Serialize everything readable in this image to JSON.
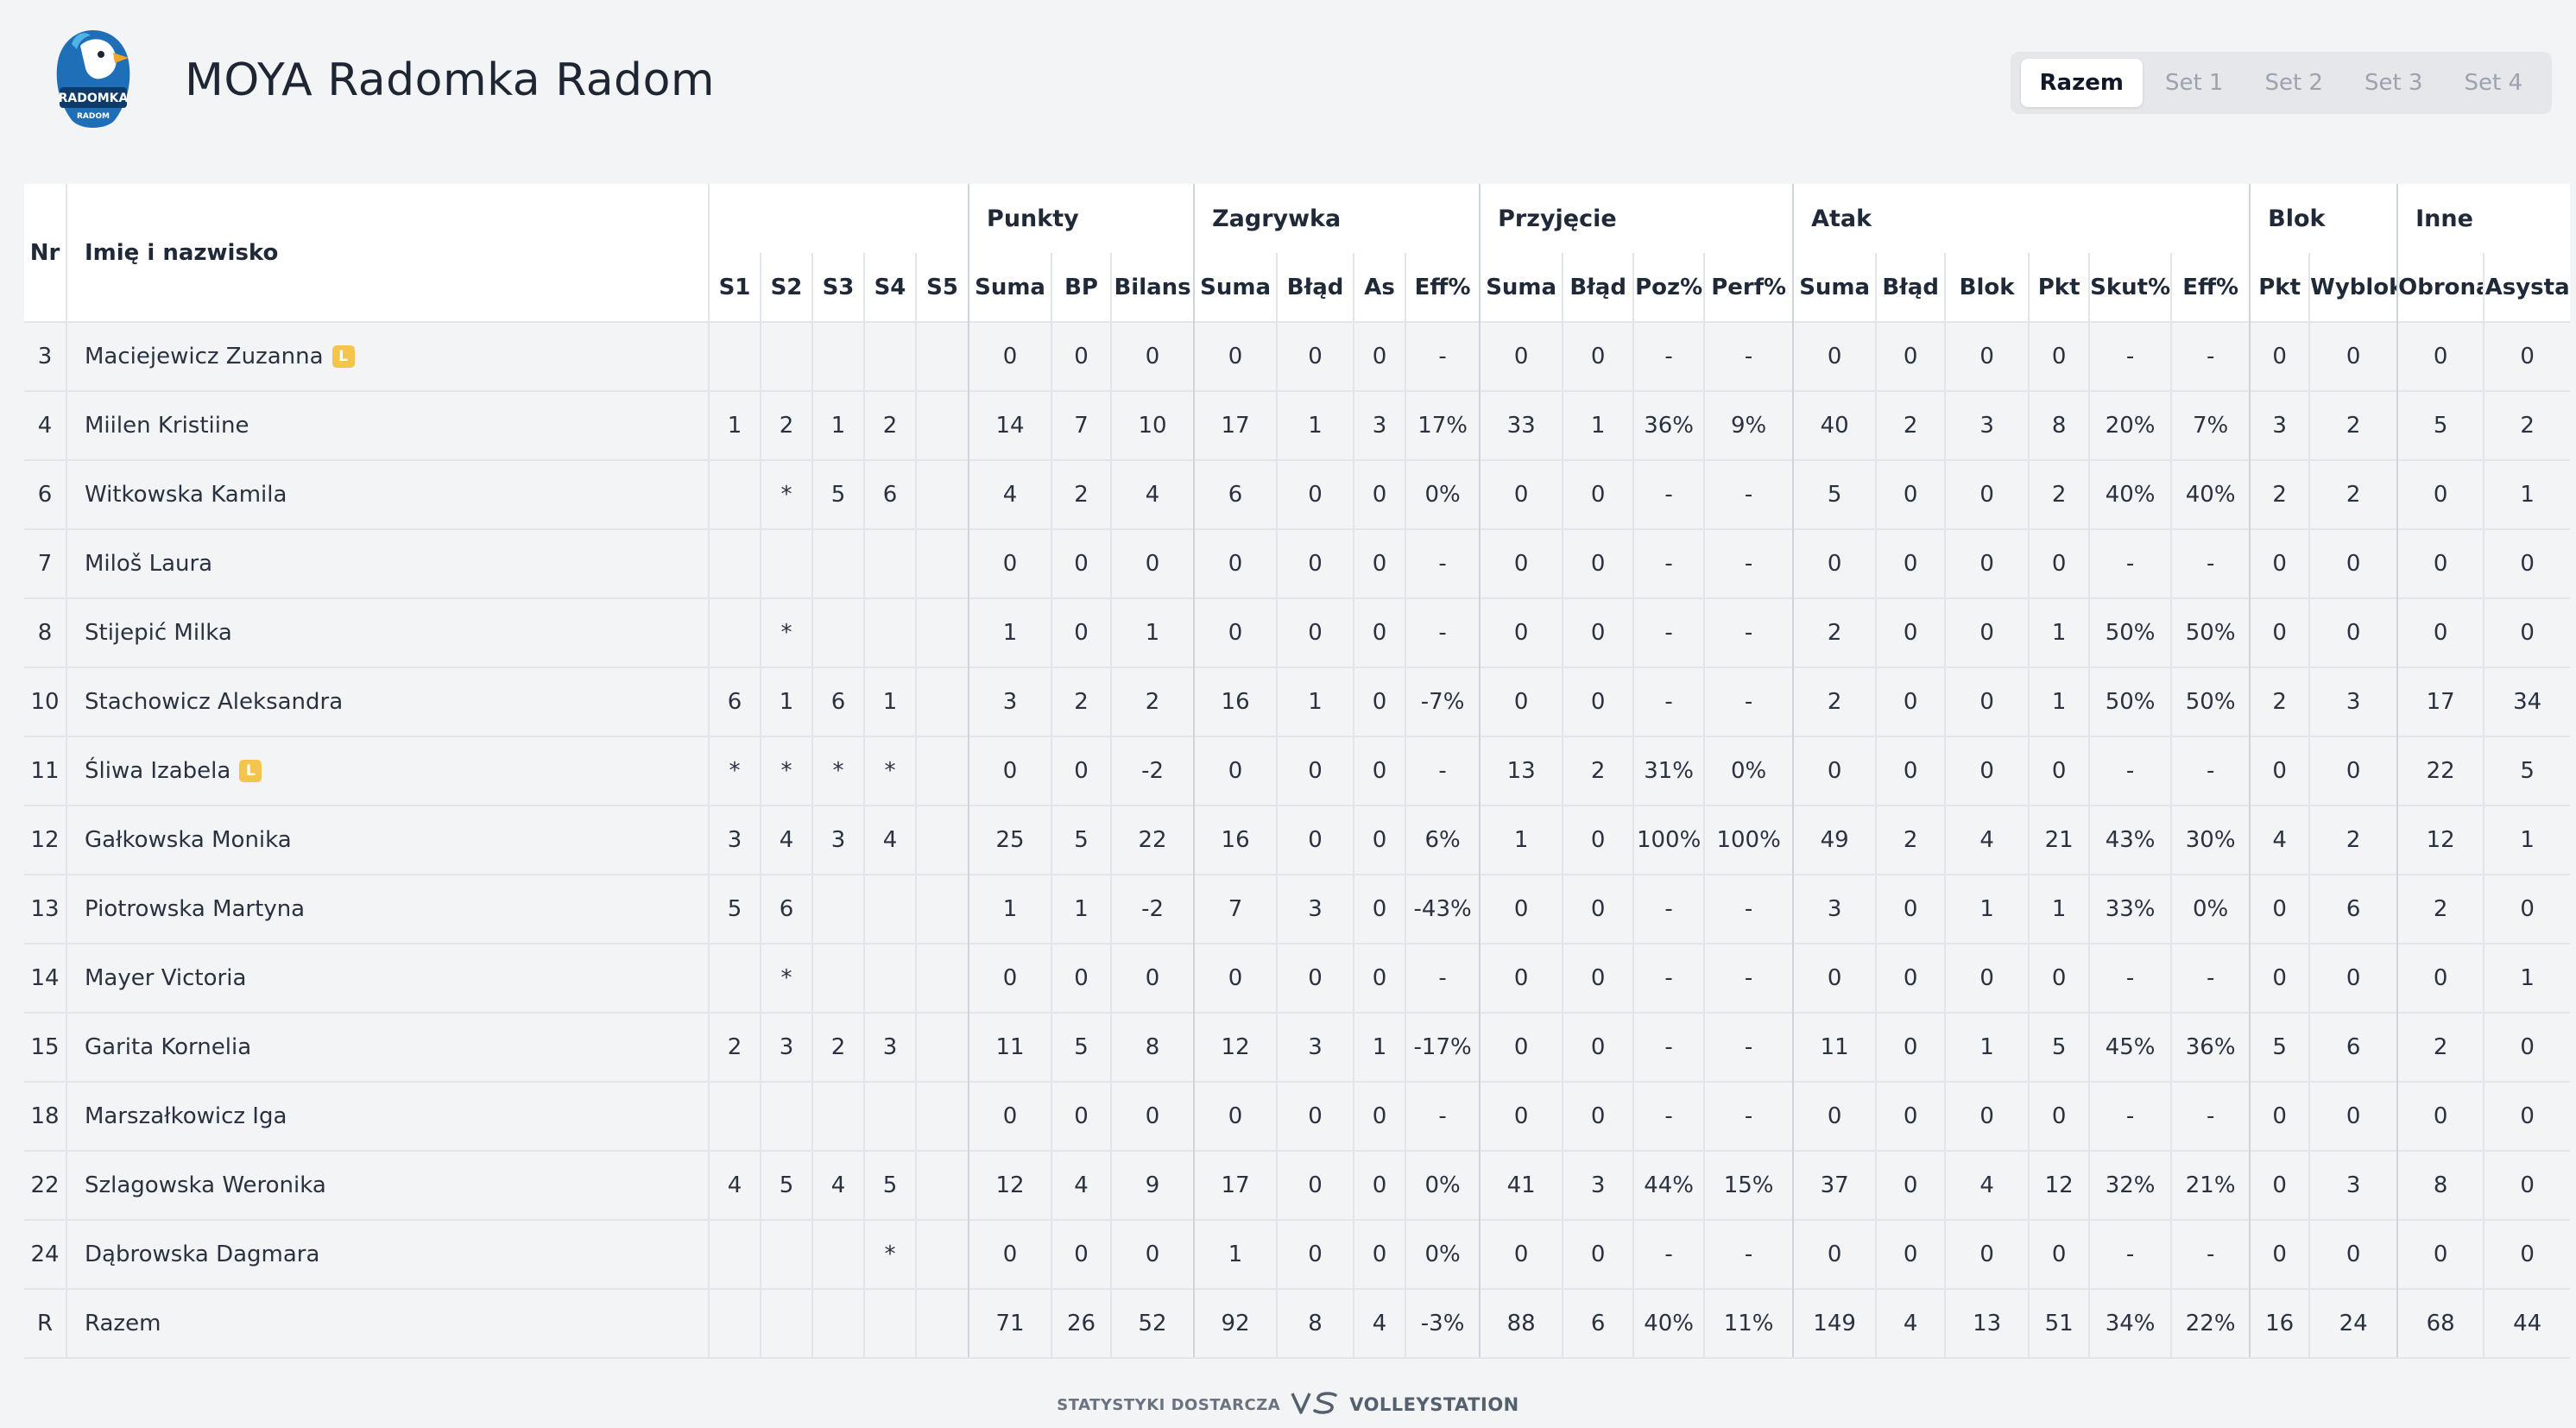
{
  "header": {
    "team_name": "MOYA Radomka Radom",
    "logo_text": "RADOMKA",
    "logo_subtext": "RADOM",
    "set_tabs": [
      "Razem",
      "Set 1",
      "Set 2",
      "Set 3",
      "Set 4"
    ],
    "active_tab": "Razem"
  },
  "table": {
    "col_nr": "Nr",
    "col_name": "Imię i nazwisko",
    "groups": [
      "Punkty",
      "Zagrywka",
      "Przyjęcie",
      "Atak",
      "Blok",
      "Inne"
    ],
    "subheaders": [
      "S1",
      "S2",
      "S3",
      "S4",
      "S5",
      "Suma",
      "BP",
      "Bilans",
      "Suma",
      "Błąd",
      "As",
      "Eff%",
      "Suma",
      "Błąd",
      "Poz%",
      "Perf%",
      "Suma",
      "Błąd",
      "Blok",
      "Pkt",
      "Skut%",
      "Eff%",
      "Pkt",
      "Wyblok",
      "Obrona",
      "Asysta"
    ],
    "rows": [
      {
        "nr": "3",
        "name": "Maciejewicz Zuzanna",
        "libero": "L",
        "cells": [
          "",
          "",
          "",
          "",
          "",
          "0",
          "0",
          "0",
          "0",
          "0",
          "0",
          "-",
          "0",
          "0",
          "-",
          "-",
          "0",
          "0",
          "0",
          "0",
          "-",
          "-",
          "0",
          "0",
          "0",
          "0"
        ]
      },
      {
        "nr": "4",
        "name": "Miilen Kristiine",
        "libero": "",
        "cells": [
          "1",
          "2",
          "1",
          "2",
          "",
          "14",
          "7",
          "10",
          "17",
          "1",
          "3",
          "17%",
          "33",
          "1",
          "36%",
          "9%",
          "40",
          "2",
          "3",
          "8",
          "20%",
          "7%",
          "3",
          "2",
          "5",
          "2"
        ]
      },
      {
        "nr": "6",
        "name": "Witkowska Kamila",
        "libero": "",
        "cells": [
          "",
          "*",
          "5",
          "6",
          "",
          "4",
          "2",
          "4",
          "6",
          "0",
          "0",
          "0%",
          "0",
          "0",
          "-",
          "-",
          "5",
          "0",
          "0",
          "2",
          "40%",
          "40%",
          "2",
          "2",
          "0",
          "1"
        ]
      },
      {
        "nr": "7",
        "name": "Miloš Laura",
        "libero": "",
        "cells": [
          "",
          "",
          "",
          "",
          "",
          "0",
          "0",
          "0",
          "0",
          "0",
          "0",
          "-",
          "0",
          "0",
          "-",
          "-",
          "0",
          "0",
          "0",
          "0",
          "-",
          "-",
          "0",
          "0",
          "0",
          "0"
        ]
      },
      {
        "nr": "8",
        "name": "Stijepić Milka",
        "libero": "",
        "cells": [
          "",
          "*",
          "",
          "",
          "",
          "1",
          "0",
          "1",
          "0",
          "0",
          "0",
          "-",
          "0",
          "0",
          "-",
          "-",
          "2",
          "0",
          "0",
          "1",
          "50%",
          "50%",
          "0",
          "0",
          "0",
          "0"
        ]
      },
      {
        "nr": "10",
        "name": "Stachowicz Aleksandra",
        "libero": "",
        "cells": [
          "6",
          "1",
          "6",
          "1",
          "",
          "3",
          "2",
          "2",
          "16",
          "1",
          "0",
          "-7%",
          "0",
          "0",
          "-",
          "-",
          "2",
          "0",
          "0",
          "1",
          "50%",
          "50%",
          "2",
          "3",
          "17",
          "34"
        ]
      },
      {
        "nr": "11",
        "name": "Śliwa Izabela",
        "libero": "L",
        "cells": [
          "*",
          "*",
          "*",
          "*",
          "",
          "0",
          "0",
          "-2",
          "0",
          "0",
          "0",
          "-",
          "13",
          "2",
          "31%",
          "0%",
          "0",
          "0",
          "0",
          "0",
          "-",
          "-",
          "0",
          "0",
          "22",
          "5"
        ]
      },
      {
        "nr": "12",
        "name": "Gałkowska Monika",
        "libero": "",
        "cells": [
          "3",
          "4",
          "3",
          "4",
          "",
          "25",
          "5",
          "22",
          "16",
          "0",
          "0",
          "6%",
          "1",
          "0",
          "100%",
          "100%",
          "49",
          "2",
          "4",
          "21",
          "43%",
          "30%",
          "4",
          "2",
          "12",
          "1"
        ]
      },
      {
        "nr": "13",
        "name": "Piotrowska Martyna",
        "libero": "",
        "cells": [
          "5",
          "6",
          "",
          "",
          "",
          "1",
          "1",
          "-2",
          "7",
          "3",
          "0",
          "-43%",
          "0",
          "0",
          "-",
          "-",
          "3",
          "0",
          "1",
          "1",
          "33%",
          "0%",
          "0",
          "6",
          "2",
          "0"
        ]
      },
      {
        "nr": "14",
        "name": "Mayer Victoria",
        "libero": "",
        "cells": [
          "",
          "*",
          "",
          "",
          "",
          "0",
          "0",
          "0",
          "0",
          "0",
          "0",
          "-",
          "0",
          "0",
          "-",
          "-",
          "0",
          "0",
          "0",
          "0",
          "-",
          "-",
          "0",
          "0",
          "0",
          "1"
        ]
      },
      {
        "nr": "15",
        "name": "Garita Kornelia",
        "libero": "",
        "cells": [
          "2",
          "3",
          "2",
          "3",
          "",
          "11",
          "5",
          "8",
          "12",
          "3",
          "1",
          "-17%",
          "0",
          "0",
          "-",
          "-",
          "11",
          "0",
          "1",
          "5",
          "45%",
          "36%",
          "5",
          "6",
          "2",
          "0"
        ]
      },
      {
        "nr": "18",
        "name": "Marszałkowicz Iga",
        "libero": "",
        "cells": [
          "",
          "",
          "",
          "",
          "",
          "0",
          "0",
          "0",
          "0",
          "0",
          "0",
          "-",
          "0",
          "0",
          "-",
          "-",
          "0",
          "0",
          "0",
          "0",
          "-",
          "-",
          "0",
          "0",
          "0",
          "0"
        ]
      },
      {
        "nr": "22",
        "name": "Szlagowska Weronika",
        "libero": "",
        "cells": [
          "4",
          "5",
          "4",
          "5",
          "",
          "12",
          "4",
          "9",
          "17",
          "0",
          "0",
          "0%",
          "41",
          "3",
          "44%",
          "15%",
          "37",
          "0",
          "4",
          "12",
          "32%",
          "21%",
          "0",
          "3",
          "8",
          "0"
        ]
      },
      {
        "nr": "24",
        "name": "Dąbrowska Dagmara",
        "libero": "",
        "cells": [
          "",
          "",
          "",
          "*",
          "",
          "0",
          "0",
          "0",
          "1",
          "0",
          "0",
          "0%",
          "0",
          "0",
          "-",
          "-",
          "0",
          "0",
          "0",
          "0",
          "-",
          "-",
          "0",
          "0",
          "0",
          "0"
        ]
      },
      {
        "nr": "R",
        "name": "Razem",
        "libero": "",
        "cells": [
          "",
          "",
          "",
          "",
          "",
          "71",
          "26",
          "52",
          "92",
          "8",
          "4",
          "-3%",
          "88",
          "6",
          "40%",
          "11%",
          "149",
          "4",
          "13",
          "51",
          "34%",
          "22%",
          "16",
          "24",
          "68",
          "44"
        ]
      }
    ]
  },
  "footer": {
    "label": "STATYSTYKI DOSTARCZA",
    "brand": "VOLLEYSTATION"
  },
  "colors": {
    "background": "#f3f4f6",
    "libero_badge": "#f5c44d",
    "logo_blue": "#1e6fb8"
  }
}
